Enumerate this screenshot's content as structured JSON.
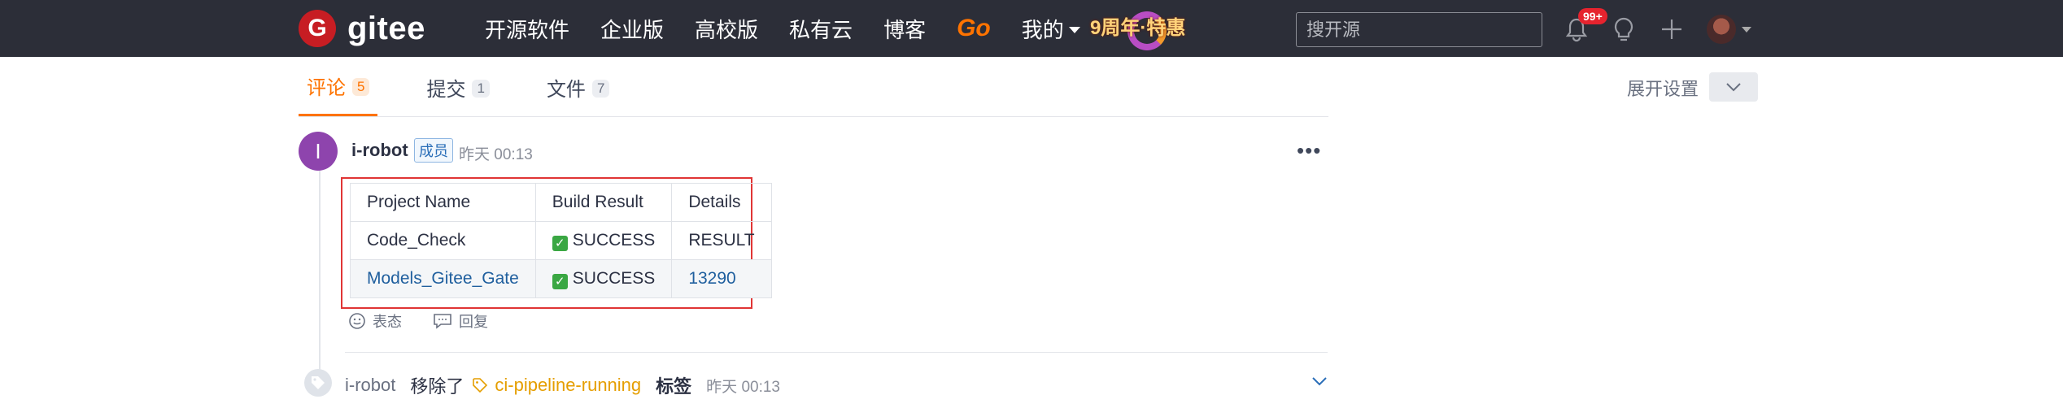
{
  "nav": {
    "brand": "gitee",
    "logo_letter": "G",
    "items": [
      "开源软件",
      "企业版",
      "高校版",
      "私有云",
      "博客"
    ],
    "go_label": "Go",
    "mine_label": "我的",
    "promo_text": "9周年·特惠",
    "search_placeholder": "搜开源",
    "notification_badge": "99+",
    "icons": [
      "bell-icon",
      "lightbulb-icon",
      "plus-icon"
    ]
  },
  "tabs": [
    {
      "label": "评论",
      "count": "5"
    },
    {
      "label": "提交",
      "count": "1"
    },
    {
      "label": "文件",
      "count": "7"
    }
  ],
  "settings": {
    "expand_label": "展开设置"
  },
  "comment": {
    "avatar_letter": "I",
    "author": "i-robot",
    "role": "成员",
    "time": "昨天 00:13",
    "table": {
      "headers": [
        "Project Name",
        "Build Result",
        "Details"
      ],
      "rows": [
        {
          "project": "Code_Check",
          "result": "SUCCESS",
          "details": "RESULT"
        },
        {
          "project": "Models_Gitee_Gate",
          "result": "SUCCESS",
          "details": "13290"
        }
      ]
    },
    "actions": {
      "react": "表态",
      "reply": "回复"
    }
  },
  "event": {
    "user": "i-robot",
    "action": "移除了",
    "label": "ci-pipeline-running",
    "noun": "标签",
    "time": "昨天 00:13"
  },
  "colors": {
    "topbar": "#2c2e38",
    "brand_red": "#c71d23",
    "accent_orange": "#fe7300",
    "highlight_border": "#e03535",
    "label_yellow": "#e59e00",
    "avatar_purple": "#8e44ad"
  }
}
